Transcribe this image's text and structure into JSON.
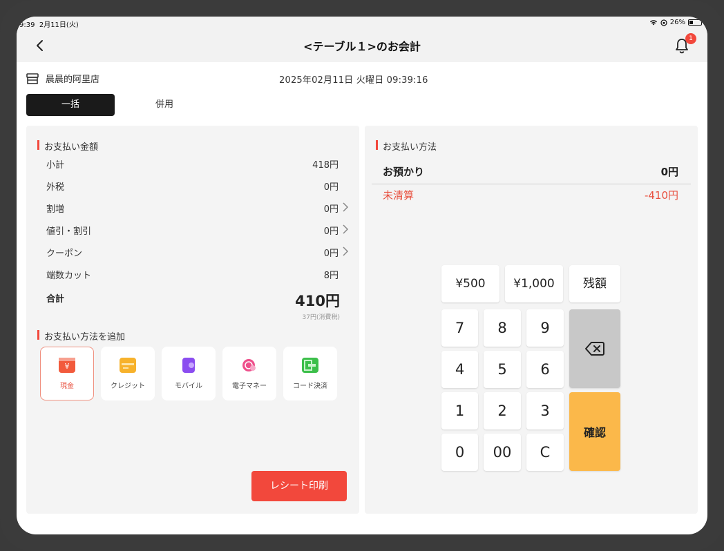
{
  "status": {
    "time": "9:39",
    "date": "2月11日(火)",
    "battery": "26%"
  },
  "nav": {
    "title": "<テーブル１>のお会計",
    "badge": "1"
  },
  "store": {
    "name": "晨晨的阿里店"
  },
  "datetime": "2025年02月11日  火曜日  09:39:16",
  "tabs": [
    "一括",
    "併用"
  ],
  "summary": {
    "title": "お支払い金額",
    "rows": [
      {
        "label": "小計",
        "value": "418円"
      },
      {
        "label": "外税",
        "value": "0円"
      },
      {
        "label": "割増",
        "value": "0円"
      },
      {
        "label": "値引・割引",
        "value": "0円"
      },
      {
        "label": "クーポン",
        "value": "0円"
      },
      {
        "label": "端数カット",
        "value": "8円"
      }
    ],
    "total_label": "合計",
    "total_value": "410円",
    "tax_note": "37円(消費税)"
  },
  "add_method": {
    "title": "お支払い方法を追加",
    "methods": [
      {
        "label": "現金",
        "icon": "cash-icon",
        "color": "#f25a3c"
      },
      {
        "label": "クレジット",
        "icon": "credit-card-icon",
        "color": "#f7b22c"
      },
      {
        "label": "モバイル",
        "icon": "mobile-icon",
        "color": "#8b4df0"
      },
      {
        "label": "電子マネー",
        "icon": "emoney-icon",
        "color": "#ee4f8b"
      },
      {
        "label": "コード決済",
        "icon": "qr-code-icon",
        "color": "#3cbf4a"
      }
    ]
  },
  "print_button": "レシート印刷",
  "payment": {
    "title": "お支払い方法",
    "deposit_label": "お預かり",
    "deposit_value": "0円",
    "unpaid_label": "未清算",
    "unpaid_value": "-410円"
  },
  "keypad": {
    "quick": [
      "¥500",
      "¥1,000",
      "残額"
    ],
    "rows": [
      [
        "7",
        "8",
        "9"
      ],
      [
        "4",
        "5",
        "6"
      ],
      [
        "1",
        "2",
        "3"
      ],
      [
        "0",
        "00",
        "C"
      ]
    ],
    "confirm": "確認"
  },
  "colors": {
    "accent": "#f2483c",
    "confirm": "#fbb84a",
    "unpaid": "#e8503f"
  }
}
